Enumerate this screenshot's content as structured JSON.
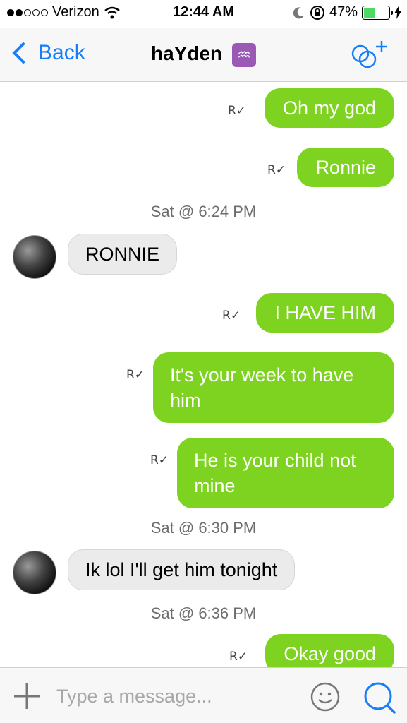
{
  "status_bar": {
    "carrier": "Verizon",
    "time": "12:44 AM",
    "battery": "47%",
    "battery_level": 0.47
  },
  "nav": {
    "back_label": "Back",
    "title": "haYden",
    "title_icon": "♒"
  },
  "messages": [
    {
      "type": "out",
      "text": "Oh my god",
      "receipt": "R✓"
    },
    {
      "type": "out",
      "text": "Ronnie",
      "receipt": "R✓"
    },
    {
      "type": "timestamp",
      "text": "Sat @ 6:24 PM"
    },
    {
      "type": "in",
      "text": "RONNIE"
    },
    {
      "type": "out",
      "text": "I HAVE HIM",
      "receipt": "R✓"
    },
    {
      "type": "out",
      "text": "It's your week to have him",
      "receipt": "R✓"
    },
    {
      "type": "out",
      "text": "He is your child not mine",
      "receipt": "R✓"
    },
    {
      "type": "timestamp",
      "text": "Sat @ 6:30 PM"
    },
    {
      "type": "in",
      "text": "Ik lol I'll get him tonight"
    },
    {
      "type": "timestamp",
      "text": "Sat @ 6:36 PM"
    },
    {
      "type": "out",
      "text": "Okay good",
      "receipt": "R✓"
    }
  ],
  "input": {
    "placeholder": "Type a message..."
  },
  "colors": {
    "accent": "#147efb",
    "outgoing_bubble": "#7ed321",
    "incoming_bubble": "#ebebeb"
  }
}
